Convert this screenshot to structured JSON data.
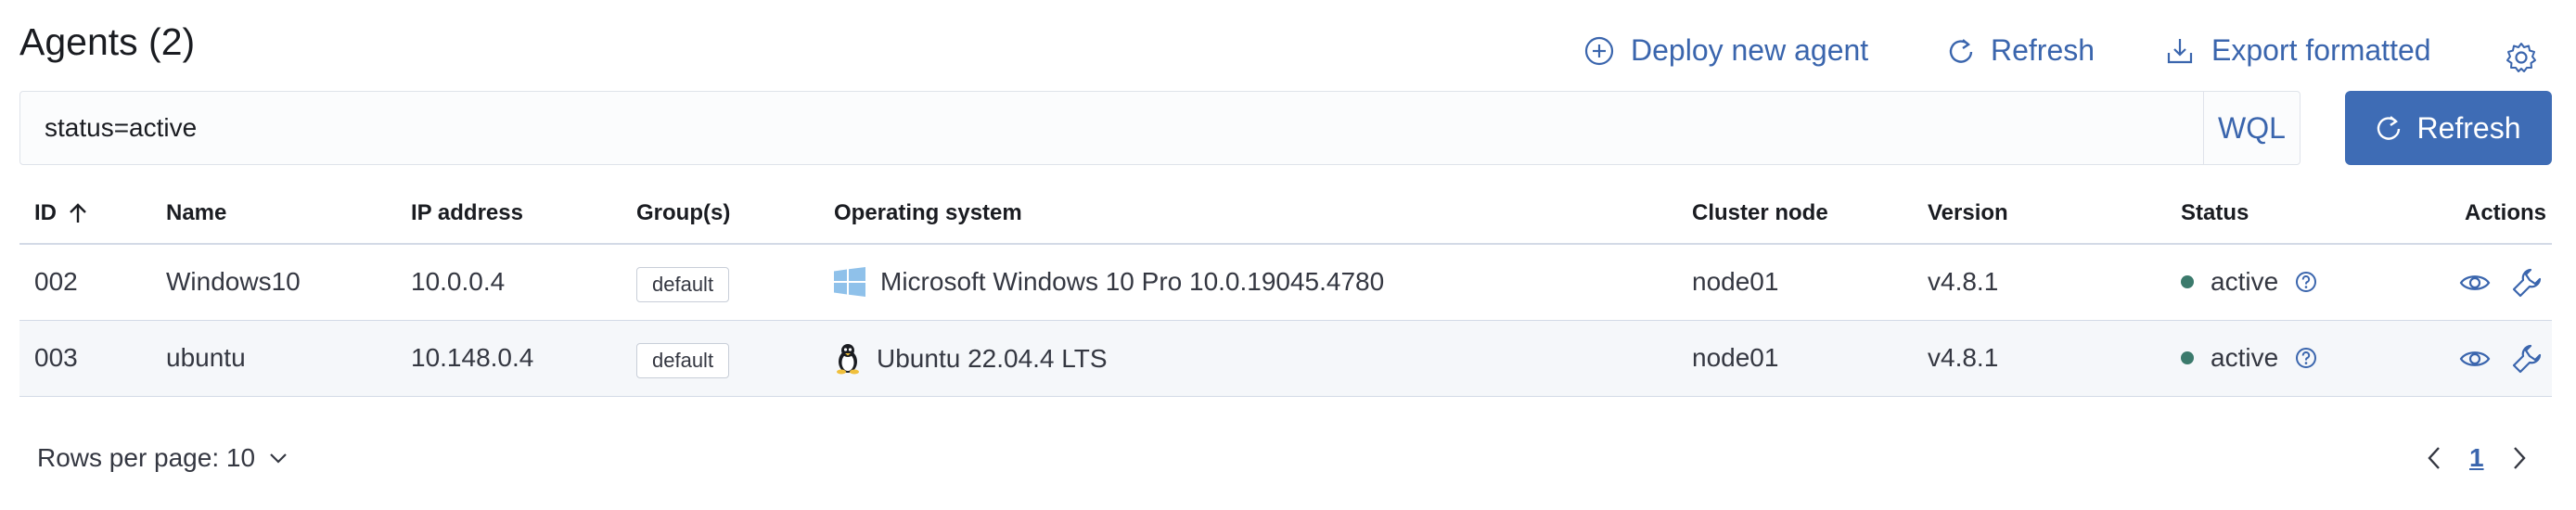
{
  "header": {
    "title": "Agents (2)",
    "deploy_label": "Deploy new agent",
    "refresh_label": "Refresh",
    "export_label": "Export formatted"
  },
  "search": {
    "value": "status=active",
    "language": "WQL",
    "refresh_button": "Refresh"
  },
  "table": {
    "columns": [
      "ID",
      "Name",
      "IP address",
      "Group(s)",
      "Operating system",
      "Cluster node",
      "Version",
      "Status",
      "Actions"
    ],
    "rows": [
      {
        "id": "002",
        "name": "Windows10",
        "ip": "10.0.0.4",
        "group": "default",
        "os": "Microsoft Windows 10 Pro 10.0.19045.4780",
        "os_icon": "windows-icon",
        "node": "node01",
        "version": "v4.8.1",
        "status": "active"
      },
      {
        "id": "003",
        "name": "ubuntu",
        "ip": "10.148.0.4",
        "group": "default",
        "os": "Ubuntu 22.04.4 LTS",
        "os_icon": "linux-icon",
        "node": "node01",
        "version": "v4.8.1",
        "status": "active"
      }
    ]
  },
  "footer": {
    "rows_per_page": "Rows per page: 10",
    "page": "1"
  },
  "colors": {
    "accent": "#3a65ad",
    "button": "#3e6cb5",
    "status_active": "#3b7a6c"
  }
}
